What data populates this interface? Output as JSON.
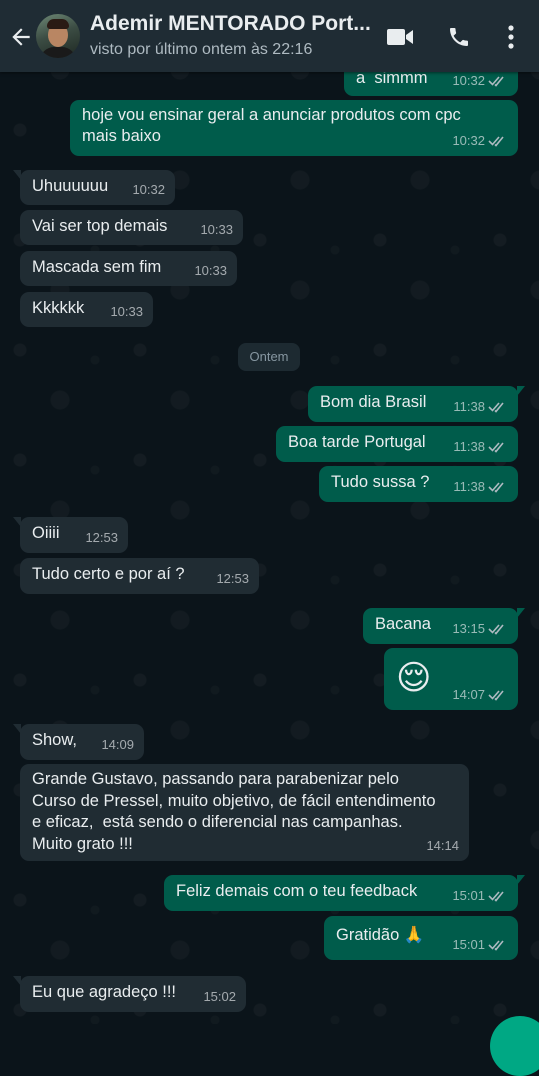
{
  "header": {
    "contact_name": "Ademir MENTORADO Port...",
    "last_seen": "visto por último ontem às 22:16"
  },
  "date_separator": "Ontem",
  "messages": {
    "m0": {
      "text": "a  simmm",
      "time": "10:32"
    },
    "m1": {
      "text": "hoje vou ensinar geral a anunciar produtos com cpc mais baixo",
      "time": "10:32"
    },
    "m2": {
      "text": "Uhuuuuuu",
      "time": "10:32"
    },
    "m3": {
      "text": "Vai ser top demais",
      "time": "10:33"
    },
    "m4": {
      "text": "Mascada sem fim",
      "time": "10:33"
    },
    "m5": {
      "text": "Kkkkkk",
      "time": "10:33"
    },
    "m6": {
      "text": "Bom dia Brasil",
      "time": "11:38"
    },
    "m7": {
      "text": "Boa tarde Portugal",
      "time": "11:38"
    },
    "m8": {
      "text": "Tudo sussa ?",
      "time": "11:38"
    },
    "m9": {
      "text": "Oiiii",
      "time": "12:53"
    },
    "m10": {
      "text": "Tudo certo e por aí ?",
      "time": "12:53"
    },
    "m11": {
      "text": "Bacana",
      "time": "13:15"
    },
    "m12": {
      "text": "😌",
      "time": "14:07"
    },
    "m13": {
      "text": "Show,",
      "time": "14:09"
    },
    "m14": {
      "text": "Grande Gustavo, passando para parabenizar pelo Curso de Pressel, muito objetivo, de fácil entendimento e eficaz,  está sendo o diferencial nas campanhas. Muito grato !!!",
      "time": "14:14"
    },
    "m15": {
      "text": "Feliz demais com o teu feedback",
      "time": "15:01"
    },
    "m16": {
      "text": "Gratidão 🙏",
      "time": "15:01"
    },
    "m17": {
      "text": "Eu que agradeço !!!",
      "time": "15:02"
    }
  },
  "colors": {
    "header_bg": "#1f2c34",
    "chat_bg": "#0b141a",
    "incoming_bubble": "#202c33",
    "outgoing_bubble": "#005c4b",
    "read_ticks": "#8ed1fc"
  },
  "icons": [
    "back-arrow-icon",
    "video-call-icon",
    "phone-icon",
    "more-options-icon",
    "double-check-icon"
  ]
}
